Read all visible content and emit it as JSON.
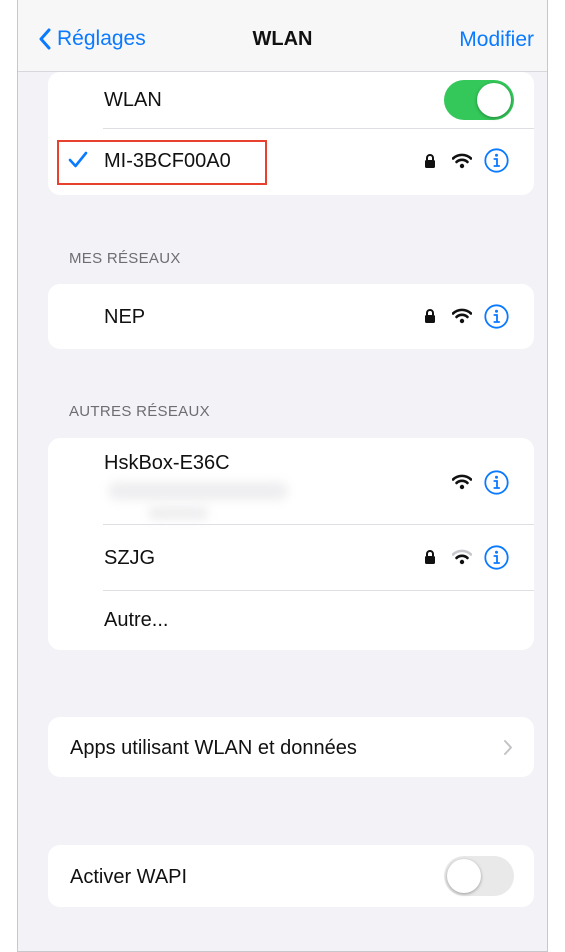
{
  "navbar": {
    "back_label": "Réglages",
    "title": "WLAN",
    "edit_label": "Modifier"
  },
  "wlan_section": {
    "toggle_label": "WLAN",
    "toggle_state": "on",
    "connected_network": {
      "name": "MI-3BCF00A0",
      "checked": true,
      "secured": true,
      "signal": "full"
    }
  },
  "my_networks": {
    "header": "MES RÉSEAUX",
    "networks": [
      {
        "name": "NEP",
        "secured": true,
        "signal": "full"
      }
    ]
  },
  "other_networks": {
    "header": "AUTRES RÉSEAUX",
    "networks": [
      {
        "name": "HskBox-E36C",
        "secured": false,
        "signal": "full"
      },
      {
        "name": "SZJG",
        "secured": true,
        "signal": "weak"
      }
    ],
    "other_label": "Autre..."
  },
  "apps_row": {
    "label": "Apps utilisant WLAN et données"
  },
  "wapi_row": {
    "label": "Activer WAPI",
    "toggle_state": "off"
  },
  "colors": {
    "accent": "#0a7aff",
    "toggle_on": "#34c759",
    "toggle_off": "#e9e9ea",
    "highlight": "#e8412d"
  }
}
